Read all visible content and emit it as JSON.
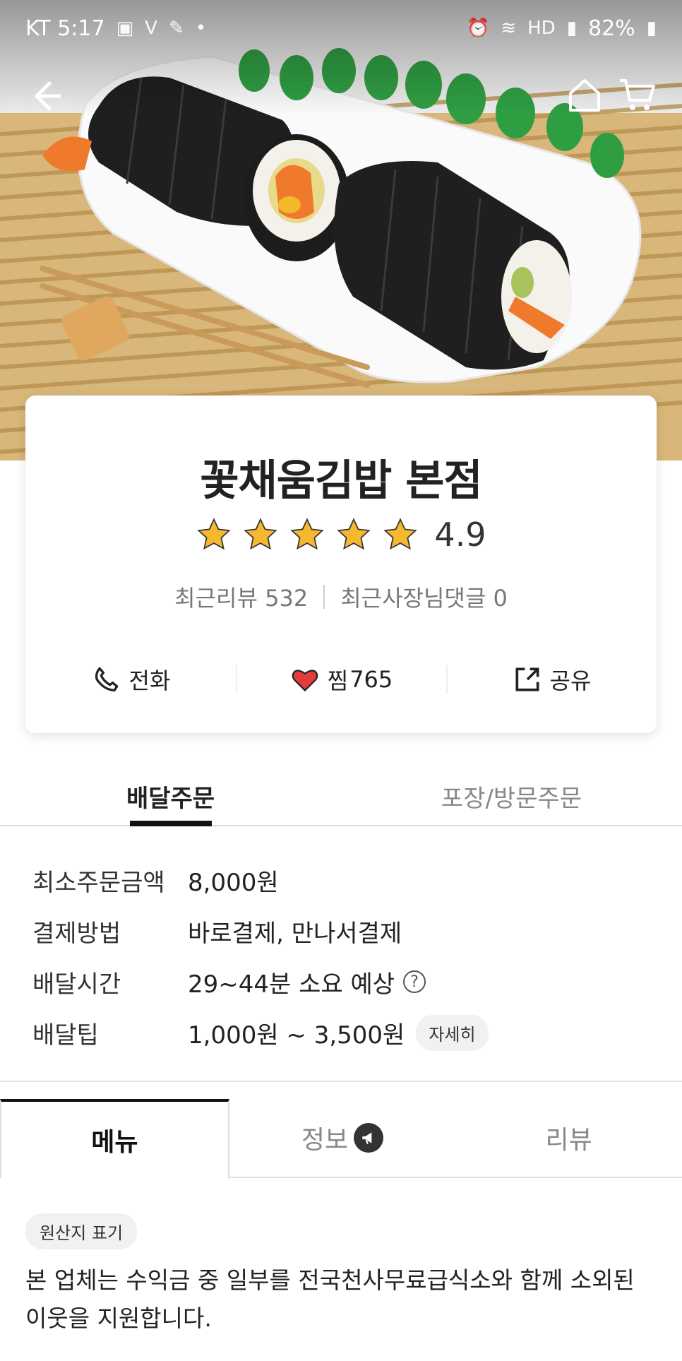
{
  "status_bar": {
    "carrier_time": "KT 5:17",
    "battery": "82%"
  },
  "icons": {
    "back": "back-arrow-icon",
    "home": "home-icon",
    "cart": "cart-icon",
    "phone": "phone-icon",
    "heart": "heart-icon",
    "share": "share-icon"
  },
  "store": {
    "name": "꽃채움김밥 본점",
    "rating": "4.9",
    "stars": 5,
    "recent_reviews": "최근리뷰 532",
    "owner_replies": "최근사장님댓글 0"
  },
  "actions": {
    "call": "전화",
    "like": "찜",
    "like_count": "765",
    "share": "공유"
  },
  "order_tabs": [
    {
      "label": "배달주문",
      "active": true
    },
    {
      "label": "포장/방문주문",
      "active": false
    }
  ],
  "info": [
    {
      "label": "최소주문금액",
      "value": "8,000원"
    },
    {
      "label": "결제방법",
      "value": "바로결제, 만나서결제"
    },
    {
      "label": "배달시간",
      "value": "29~44분 소요 예상"
    },
    {
      "label": "배달팁",
      "value": "1,000원 ~ 3,500원",
      "chip": "자세히"
    }
  ],
  "menu_tabs": [
    {
      "label": "메뉴",
      "active": true
    },
    {
      "label": "정보",
      "active": false
    },
    {
      "label": "리뷰",
      "active": false
    }
  ],
  "origin_chip": "원산지 표기",
  "notice": "본 업체는 수익금 중 일부를 전국천사무료급식소와 함께 소외된 이웃을 지원합니다.",
  "colors": {
    "star": "#F5B82E",
    "heart": "#E63B3B",
    "active_underline": "#111111"
  }
}
